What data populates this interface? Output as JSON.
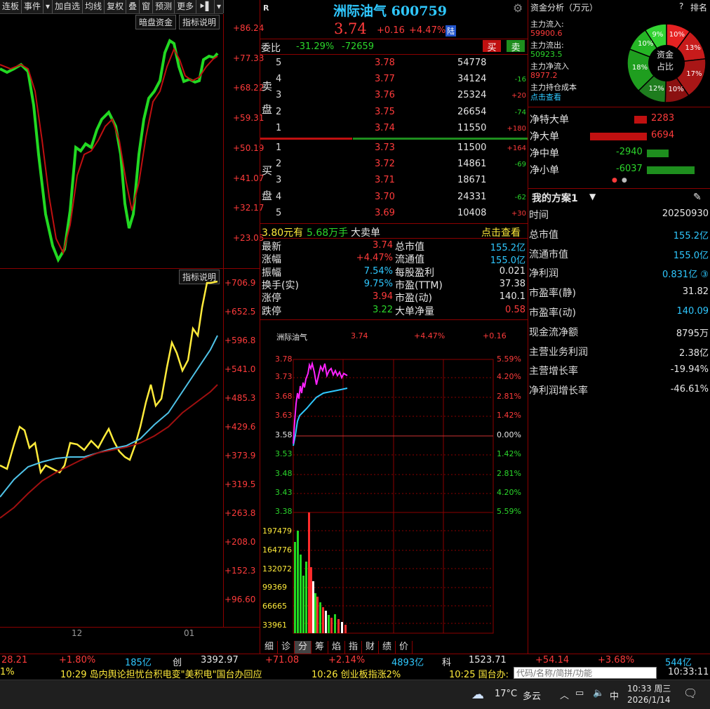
{
  "toolbar": {
    "items": [
      "连板",
      "事件",
      "▾",
      "加自选",
      "均线",
      "复权",
      "叠",
      "窗",
      "预测",
      "更多",
      "⯈▌",
      "▾"
    ],
    "dark_pool": "暗盘资金",
    "indicator_desc": "指标说明"
  },
  "upper_chart": {
    "yticks": [
      "+86.24",
      "+77.33",
      "+68.22",
      "+59.31",
      "+50.19",
      "+41.07",
      "+32.17",
      "+23.05"
    ]
  },
  "lower_chart": {
    "indicator_desc": "指标说明",
    "yticks": [
      "+706.9",
      "+652.5",
      "+596.8",
      "+541.0",
      "+485.3",
      "+429.6",
      "+373.9",
      "+319.5",
      "+263.8",
      "+208.0",
      "+152.3",
      "+96.60"
    ],
    "xticks": [
      "12",
      "01"
    ]
  },
  "stock": {
    "badge": "R",
    "name": "洲际油气 600759",
    "price": "3.74",
    "change": "+0.16",
    "change_pct": "+4.47%",
    "lu_badge": "陆"
  },
  "weibi": {
    "label": "委比",
    "pct": "-31.29%",
    "diff": "-72659",
    "sell_btn": "买",
    "buy_btn": "卖"
  },
  "asks": [
    {
      "level": "5",
      "price": "3.78",
      "volume": "54778",
      "delta": ""
    },
    {
      "level": "4",
      "price": "3.77",
      "volume": "34124",
      "delta": "-16"
    },
    {
      "level": "3",
      "price": "3.76",
      "volume": "25324",
      "delta": "+20"
    },
    {
      "level": "2",
      "price": "3.75",
      "volume": "26654",
      "delta": "-74"
    },
    {
      "level": "1",
      "price": "3.74",
      "volume": "11550",
      "delta": "+180"
    }
  ],
  "ask_label": [
    "卖",
    "盘"
  ],
  "bids": [
    {
      "level": "1",
      "price": "3.73",
      "volume": "11500",
      "delta": "+164"
    },
    {
      "level": "2",
      "price": "3.72",
      "volume": "14861",
      "delta": "-69"
    },
    {
      "level": "3",
      "price": "3.71",
      "volume": "18671",
      "delta": ""
    },
    {
      "level": "4",
      "price": "3.70",
      "volume": "24331",
      "delta": "-62"
    },
    {
      "level": "5",
      "price": "3.69",
      "volume": "10408",
      "delta": "+30"
    }
  ],
  "bid_label": [
    "买",
    "盘"
  ],
  "big_order": {
    "price": "3.80元有",
    "amount": "5.68万手",
    "label": "大卖单",
    "link": "点击查看"
  },
  "quote_left": [
    {
      "k": "最新",
      "v": "3.74",
      "c": "red"
    },
    {
      "k": "涨幅",
      "v": "+4.47%",
      "c": "red"
    },
    {
      "k": "振幅",
      "v": "7.54%",
      "c": "cyan"
    },
    {
      "k": "换手(实)",
      "v": "9.75%",
      "c": "cyan"
    },
    {
      "k": "涨停",
      "v": "3.94",
      "c": "red"
    },
    {
      "k": "跌停",
      "v": "3.22",
      "c": "green"
    }
  ],
  "quote_right": [
    {
      "k": "总市值",
      "v": "155.2亿",
      "c": "cyan"
    },
    {
      "k": "流通值",
      "v": "155.0亿",
      "c": "cyan"
    },
    {
      "k": "每股盈利",
      "v": "0.021",
      "c": "white"
    },
    {
      "k": "市盈(TTM)",
      "v": "37.38",
      "c": "white"
    },
    {
      "k": "市盈(动)",
      "v": "140.1",
      "c": "white"
    },
    {
      "k": "大单净量",
      "v": "0.58",
      "c": "red"
    }
  ],
  "intraday": {
    "name": "洲际油气",
    "price": "3.74",
    "pct": "+4.47%",
    "chg": "+0.16",
    "left_ticks": [
      "3.78",
      "3.73",
      "3.68",
      "3.63",
      "3.58",
      "3.53",
      "3.48",
      "3.43",
      "3.38"
    ],
    "right_ticks": [
      "5.59%",
      "4.20%",
      "2.81%",
      "1.42%",
      "0.00%",
      "1.42%",
      "2.81%",
      "4.20%",
      "5.59%"
    ],
    "vol_ticks": [
      "197479",
      "164776",
      "132072",
      "99369",
      "66665",
      "33961"
    ]
  },
  "bottom_tabs": [
    "细",
    "诊",
    "分",
    "筹",
    "焰",
    "指",
    "财",
    "绩",
    "价"
  ],
  "capital": {
    "title": "资金分析（万元）",
    "help": "?",
    "rank": "排名",
    "inflow_label": "主力流入:",
    "inflow": "59900.6",
    "outflow_label": "主力流出:",
    "outflow": "50923.5",
    "net_label": "主力净流入",
    "net": "8977.2",
    "cost_label": "主力持仓成本",
    "cost_link": "点击查看",
    "donut_center": [
      "资金",
      "占比"
    ],
    "donut_labels": [
      "10%",
      "13%",
      "17%",
      "10%",
      "12%",
      "18%",
      "10%",
      "9%"
    ]
  },
  "flows": [
    {
      "k": "净特大单",
      "v": "2283",
      "sign": 1,
      "mag": 0.2
    },
    {
      "k": "净大单",
      "v": "6694",
      "sign": 1,
      "mag": 0.9
    },
    {
      "k": "净中单",
      "v": "-2940",
      "sign": -1,
      "mag": 0.35
    },
    {
      "k": "净小单",
      "v": "-6037",
      "sign": -1,
      "mag": 0.75
    }
  ],
  "plan": {
    "title": "我的方案1",
    "rows": [
      {
        "k": "时间",
        "v": "20250930",
        "c": "white"
      },
      {
        "k": "总市值",
        "v": "155.2亿",
        "c": "cyan"
      },
      {
        "k": "流通市值",
        "v": "155.0亿",
        "c": "cyan"
      },
      {
        "k": "净利润",
        "v": "0.831亿 ③",
        "c": "cyan"
      },
      {
        "k": "市盈率(静)",
        "v": "31.82",
        "c": "white"
      },
      {
        "k": "市盈率(动)",
        "v": "140.09",
        "c": "cyan"
      },
      {
        "k": "现金流净额",
        "v": "8795万",
        "c": "white"
      },
      {
        "k": "主营业务利润",
        "v": "2.38亿",
        "c": "white"
      },
      {
        "k": "主营增长率",
        "v": "-19.94%",
        "c": "white"
      },
      {
        "k": "净利润增长率",
        "v": "-46.61%",
        "c": "white"
      }
    ]
  },
  "ticker": {
    "a": "28.21",
    "a_pct": "+1.80%",
    "a_amt": "185亿",
    "chuang": "创",
    "c_val": "3392.97",
    "c_chg": "+71.08",
    "c_pct": "+2.14%",
    "c_amt": "4893亿",
    "ke": "科",
    "k_val": "1523.71",
    "k_chg": "+54.14",
    "k_pct": "+3.68%",
    "k_amt": "544亿"
  },
  "news": {
    "lead": "1%",
    "n1": "10:29 岛内舆论担忧台积电变\"美积电\"国台办回应",
    "n2": "10:26 创业板指涨2%",
    "n3": "10:25 国台办:",
    "search_placeholder": "代码/名称/简拼/功能",
    "clock": "10:33:11"
  },
  "taskbar": {
    "temp": "17°C",
    "weather": "多云",
    "ime": "中",
    "time": "10:33 周三",
    "date": "2026/1/14"
  }
}
